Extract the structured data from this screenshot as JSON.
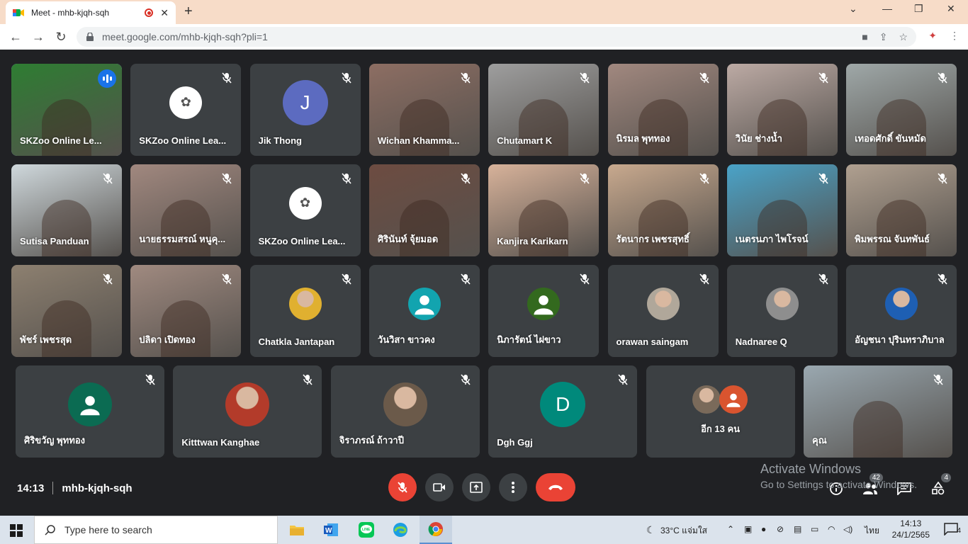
{
  "browser": {
    "tab_title": "Meet - mhb-kjqh-sqh",
    "url": "meet.google.com/mhb-kjqh-sqh?pli=1"
  },
  "participants": [
    {
      "name": "SKZoo Online Le...",
      "kind": "video",
      "bg": "#2e7d32",
      "active": true
    },
    {
      "name": "SKZoo Online Lea...",
      "kind": "logo"
    },
    {
      "name": "Jik Thong",
      "kind": "letter",
      "letter": "J",
      "color": "#5c6bc0"
    },
    {
      "name": "Wichan Khamma...",
      "kind": "video",
      "bg": "#8d6e63"
    },
    {
      "name": "Chutamart K",
      "kind": "video",
      "bg": "#9e9e9e"
    },
    {
      "name": "นิรมล พุททอง",
      "kind": "video",
      "bg": "#a1887f"
    },
    {
      "name": "วินัย ช่างน้ำ",
      "kind": "video",
      "bg": "#bcaaa4"
    },
    {
      "name": "เทอดศักดิ์ ขันหมัด",
      "kind": "video",
      "bg": "#9fa8a8"
    },
    {
      "name": "Sutisa Panduan",
      "kind": "video",
      "bg": "#cfd8dc"
    },
    {
      "name": "นายธรรมสรณ์ หนูคุ...",
      "kind": "video",
      "bg": "#a1887f"
    },
    {
      "name": "SKZoo Online Lea...",
      "kind": "logo"
    },
    {
      "name": "ศิรินันท์ จุ้ยมอด",
      "kind": "video",
      "bg": "#6d4c41"
    },
    {
      "name": "Kanjira Karikarn",
      "kind": "video",
      "bg": "#d7b29a"
    },
    {
      "name": "รัตนากร เพชรสุทธิ์",
      "kind": "video",
      "bg": "#c8a98e"
    },
    {
      "name": "เนตรนภา ไพโรจน์",
      "kind": "video",
      "bg": "#4aa3c8"
    },
    {
      "name": "พิมพรรณ จันทพันธ์",
      "kind": "video",
      "bg": "#b0a090"
    },
    {
      "name": "พัชร์ เพชรสุด",
      "kind": "video",
      "bg": "#8d8070"
    },
    {
      "name": "ปลิดา เปิดทอง",
      "kind": "video",
      "bg": "#a08a80"
    },
    {
      "name": "Chatkla Jantapan",
      "kind": "photo",
      "color": "#e0b030"
    },
    {
      "name": "วันวิสา ขาวคง",
      "kind": "person",
      "color": "#12a4af"
    },
    {
      "name": "นิภารัตน์ ไฝขาว",
      "kind": "person",
      "color": "#33691e"
    },
    {
      "name": "orawan saingam",
      "kind": "photo",
      "color": "#b0a79a"
    },
    {
      "name": "Nadnaree Q",
      "kind": "photo",
      "color": "#8e8e8e"
    },
    {
      "name": "อัญชนา ปุรินทราภิบาล",
      "kind": "photo",
      "color": "#1e5fb3"
    },
    {
      "name": "ศิริขวัญ พุททอง",
      "kind": "person",
      "color": "#0b6b52"
    },
    {
      "name": "Kitttwan Kanghae",
      "kind": "photo",
      "color": "#b33b2a"
    },
    {
      "name": "จิราภรณ์ ถ้าวาปี",
      "kind": "photo",
      "color": "#6b5a4a"
    },
    {
      "name": "Dgh Ggj",
      "kind": "letter",
      "letter": "D",
      "color": "#00897b"
    },
    {
      "name": "อีก 13 คน",
      "kind": "more"
    },
    {
      "name": "คุณ",
      "kind": "video",
      "bg": "#9aa8b0"
    }
  ],
  "meeting": {
    "time": "14:13",
    "code": "mhb-kjqh-sqh",
    "people_count": "42",
    "chat_count": "4"
  },
  "watermark": {
    "line1": "Activate Windows",
    "line2": "Go to Settings to activate Windows."
  },
  "taskbar": {
    "search_placeholder": "Type here to search",
    "weather": "33°C  แจ่มใส",
    "lang": "ไทย",
    "time": "14:13",
    "date": "24/1/2565",
    "notifications": "4"
  }
}
